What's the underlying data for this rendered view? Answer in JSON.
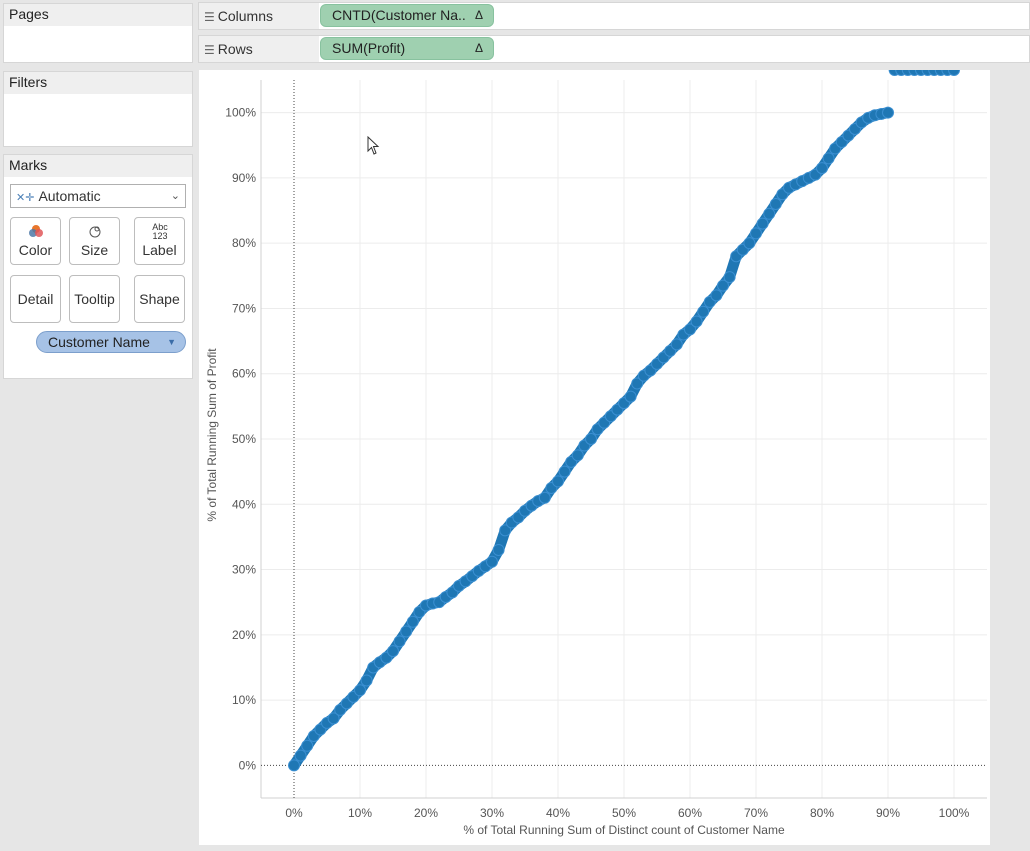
{
  "left_panels": {
    "pages": {
      "title": "Pages"
    },
    "filters": {
      "title": "Filters"
    },
    "marks": {
      "title": "Marks",
      "mark_type": "Automatic",
      "buttons": [
        {
          "label": "Color",
          "icon": "color-icon"
        },
        {
          "label": "Size",
          "icon": "size-icon"
        },
        {
          "label": "Label",
          "icon": "label-icon",
          "glyph": "Abc 123"
        },
        {
          "label": "Detail"
        },
        {
          "label": "Tooltip"
        },
        {
          "label": "Shape"
        }
      ],
      "field_pill": "Customer Name"
    }
  },
  "shelves": {
    "columns": {
      "label": "Columns",
      "pill": "CNTD(Customer Na..",
      "pill_icon": "Δ"
    },
    "rows": {
      "label": "Rows",
      "pill": "SUM(Profit)",
      "pill_icon": "Δ"
    }
  },
  "chart_data": {
    "type": "scatter",
    "xlabel": "% of Total Running Sum of Distinct count of Customer Name",
    "ylabel": "% of Total Running Sum of Profit",
    "xlim": [
      -0.05,
      1.05
    ],
    "ylim": [
      -0.05,
      1.05
    ],
    "x_ticks": [
      "0%",
      "10%",
      "20%",
      "30%",
      "40%",
      "50%",
      "60%",
      "70%",
      "80%",
      "90%",
      "100%"
    ],
    "y_ticks": [
      "0%",
      "10%",
      "20%",
      "30%",
      "40%",
      "50%",
      "60%",
      "70%",
      "80%",
      "90%",
      "100%"
    ],
    "grid": true,
    "mark_color": "#1f77b4",
    "x": [
      0.0,
      0.01,
      0.02,
      0.03,
      0.04,
      0.05,
      0.06,
      0.07,
      0.08,
      0.09,
      0.1,
      0.11,
      0.12,
      0.13,
      0.14,
      0.15,
      0.16,
      0.17,
      0.18,
      0.19,
      0.2,
      0.21,
      0.22,
      0.23,
      0.24,
      0.25,
      0.26,
      0.27,
      0.28,
      0.29,
      0.3,
      0.31,
      0.32,
      0.33,
      0.34,
      0.35,
      0.36,
      0.37,
      0.38,
      0.39,
      0.4,
      0.41,
      0.42,
      0.43,
      0.44,
      0.45,
      0.46,
      0.47,
      0.48,
      0.49,
      0.5,
      0.51,
      0.52,
      0.53,
      0.54,
      0.55,
      0.56,
      0.57,
      0.58,
      0.59,
      0.6,
      0.61,
      0.62,
      0.63,
      0.64,
      0.65,
      0.66,
      0.67,
      0.68,
      0.69,
      0.7,
      0.71,
      0.72,
      0.73,
      0.74,
      0.75,
      0.76,
      0.77,
      0.78,
      0.79,
      0.8,
      0.81,
      0.82,
      0.83,
      0.84,
      0.85,
      0.86,
      0.87,
      0.88,
      0.89,
      0.9,
      0.91,
      0.92,
      0.93,
      0.94,
      0.95,
      0.96,
      0.97,
      0.98,
      0.99,
      1.0
    ],
    "y": [
      0.0,
      0.015,
      0.03,
      0.045,
      0.055,
      0.065,
      0.072,
      0.085,
      0.095,
      0.105,
      0.115,
      0.13,
      0.15,
      0.158,
      0.165,
      0.175,
      0.19,
      0.205,
      0.22,
      0.235,
      0.245,
      0.248,
      0.25,
      0.258,
      0.265,
      0.275,
      0.282,
      0.29,
      0.298,
      0.305,
      0.312,
      0.33,
      0.36,
      0.372,
      0.38,
      0.39,
      0.398,
      0.405,
      0.41,
      0.425,
      0.435,
      0.45,
      0.465,
      0.475,
      0.49,
      0.5,
      0.515,
      0.525,
      0.535,
      0.545,
      0.555,
      0.565,
      0.585,
      0.597,
      0.605,
      0.615,
      0.625,
      0.635,
      0.645,
      0.66,
      0.668,
      0.68,
      0.695,
      0.71,
      0.72,
      0.735,
      0.748,
      0.78,
      0.79,
      0.8,
      0.815,
      0.83,
      0.845,
      0.86,
      0.875,
      0.885,
      0.89,
      0.895,
      0.9,
      0.905,
      0.915,
      0.93,
      0.945,
      0.955,
      0.965,
      0.975,
      0.985,
      0.992,
      0.996,
      0.998,
      1.0
    ]
  }
}
